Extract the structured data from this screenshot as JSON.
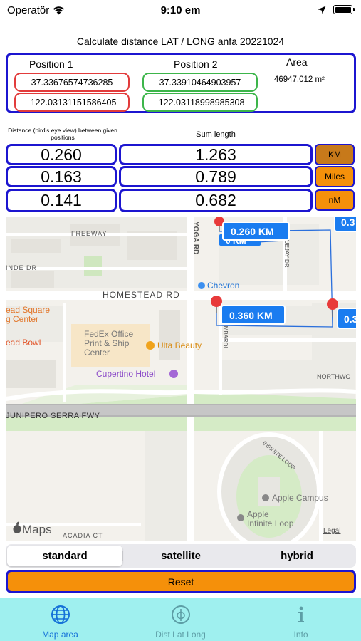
{
  "status_bar": {
    "carrier": "Operatör",
    "time": "9:10 em"
  },
  "title": "Calculate distance LAT / LONG anfa 20221024",
  "positions": {
    "pos1_label": "Position 1",
    "pos2_label": "Position 2",
    "area_label": "Area",
    "pos1_lat": "37.33676574736285",
    "pos1_long": "-122.03131151586405",
    "pos2_lat": "37.33910464903957",
    "pos2_long": "-122.03118998985308",
    "area_value": "= 46947.012 m²"
  },
  "distance_caption": "Distance (bird's eye view) between given positions",
  "sum_caption": "Sum length",
  "rows": [
    {
      "distance": "0.260",
      "sum": "1.263",
      "unit": "KM"
    },
    {
      "distance": "0.163",
      "sum": "0.789",
      "unit": "Miles"
    },
    {
      "distance": "0.141",
      "sum": "0.682",
      "unit": "nM"
    }
  ],
  "map": {
    "streets": {
      "freeway": "FREEWAY",
      "yoga": "YOGA RD",
      "inde": "INDE DR",
      "homestead": "HOMESTEAD RD",
      "bluejay": "BLUEJAY DR",
      "lombardi": "LOMBARDI",
      "northwo": "NORTHWO",
      "junipero": "JUNIPERO SERRA FWY",
      "infinite": "INFINITE LOOP",
      "acadia": "ACADIA CT"
    },
    "places": {
      "chevron": "Chevron",
      "headsquare1": "ead Square",
      "headsquare2": "g Center",
      "headbowl": "ead Bowl",
      "fedex1": "FedEx Office",
      "fedex2": "Print & Ship",
      "fedex3": "Center",
      "ulta": "Ulta Beauty",
      "cupertino": "Cupertino Hotel",
      "applecampus": "Apple Campus",
      "appleloop1": "Apple",
      "appleloop2": "Infinite Loop"
    },
    "labels": {
      "km_top": "0.260 KM",
      "km_top_partial": "0 KM",
      "km_mid": "0.360 KM",
      "km_right_top": "0.3",
      "km_right_mid": "0.3"
    },
    "attribution": {
      "logo": "Maps",
      "legal": "Legal"
    }
  },
  "map_types": [
    "standard",
    "satellite",
    "hybrid"
  ],
  "reset_label": "Reset",
  "tabs": [
    {
      "label": "Map area",
      "icon": "globe-icon"
    },
    {
      "label": "Dist Lat Long",
      "icon": "phi-icon"
    },
    {
      "label": "Info",
      "icon": "info-icon"
    }
  ],
  "colors": {
    "frame_blue": "#1c15d0",
    "orange": "#f5900a",
    "dark_orange": "#c7791a",
    "tab_bar": "#9ff0ef",
    "tab_active": "#1571d8",
    "map_label": "#1a7cf0"
  }
}
